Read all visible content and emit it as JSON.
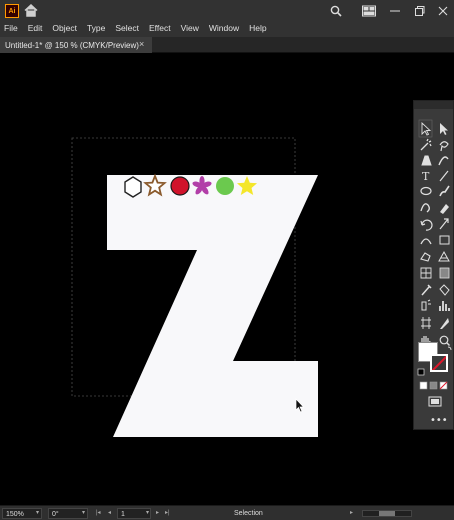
{
  "app": {
    "logo_text": "Ai"
  },
  "menu": {
    "items": [
      "File",
      "Edit",
      "Object",
      "Type",
      "Select",
      "Effect",
      "View",
      "Window",
      "Help"
    ]
  },
  "tab": {
    "label": "Untitled-1* @ 150 % (CMYK/Preview)",
    "close": "×"
  },
  "canvas": {
    "artwork_letter": "Z",
    "shapes": [
      "hexagon",
      "star",
      "circle",
      "flower",
      "circle",
      "star"
    ],
    "shape_colors": {
      "hexagon": "#ffffff",
      "star1": "#8a5a2c",
      "circle1": "#d0132b",
      "flower": "#b23fa8",
      "circle2": "#6bc94e",
      "star2": "#f4e62a"
    }
  },
  "tools_panel": {
    "fill_color": "#ffffff",
    "stroke": "none"
  },
  "status": {
    "zoom": "150%",
    "rotation": "0°",
    "artboard_number": "1",
    "tool_name": "Selection"
  }
}
